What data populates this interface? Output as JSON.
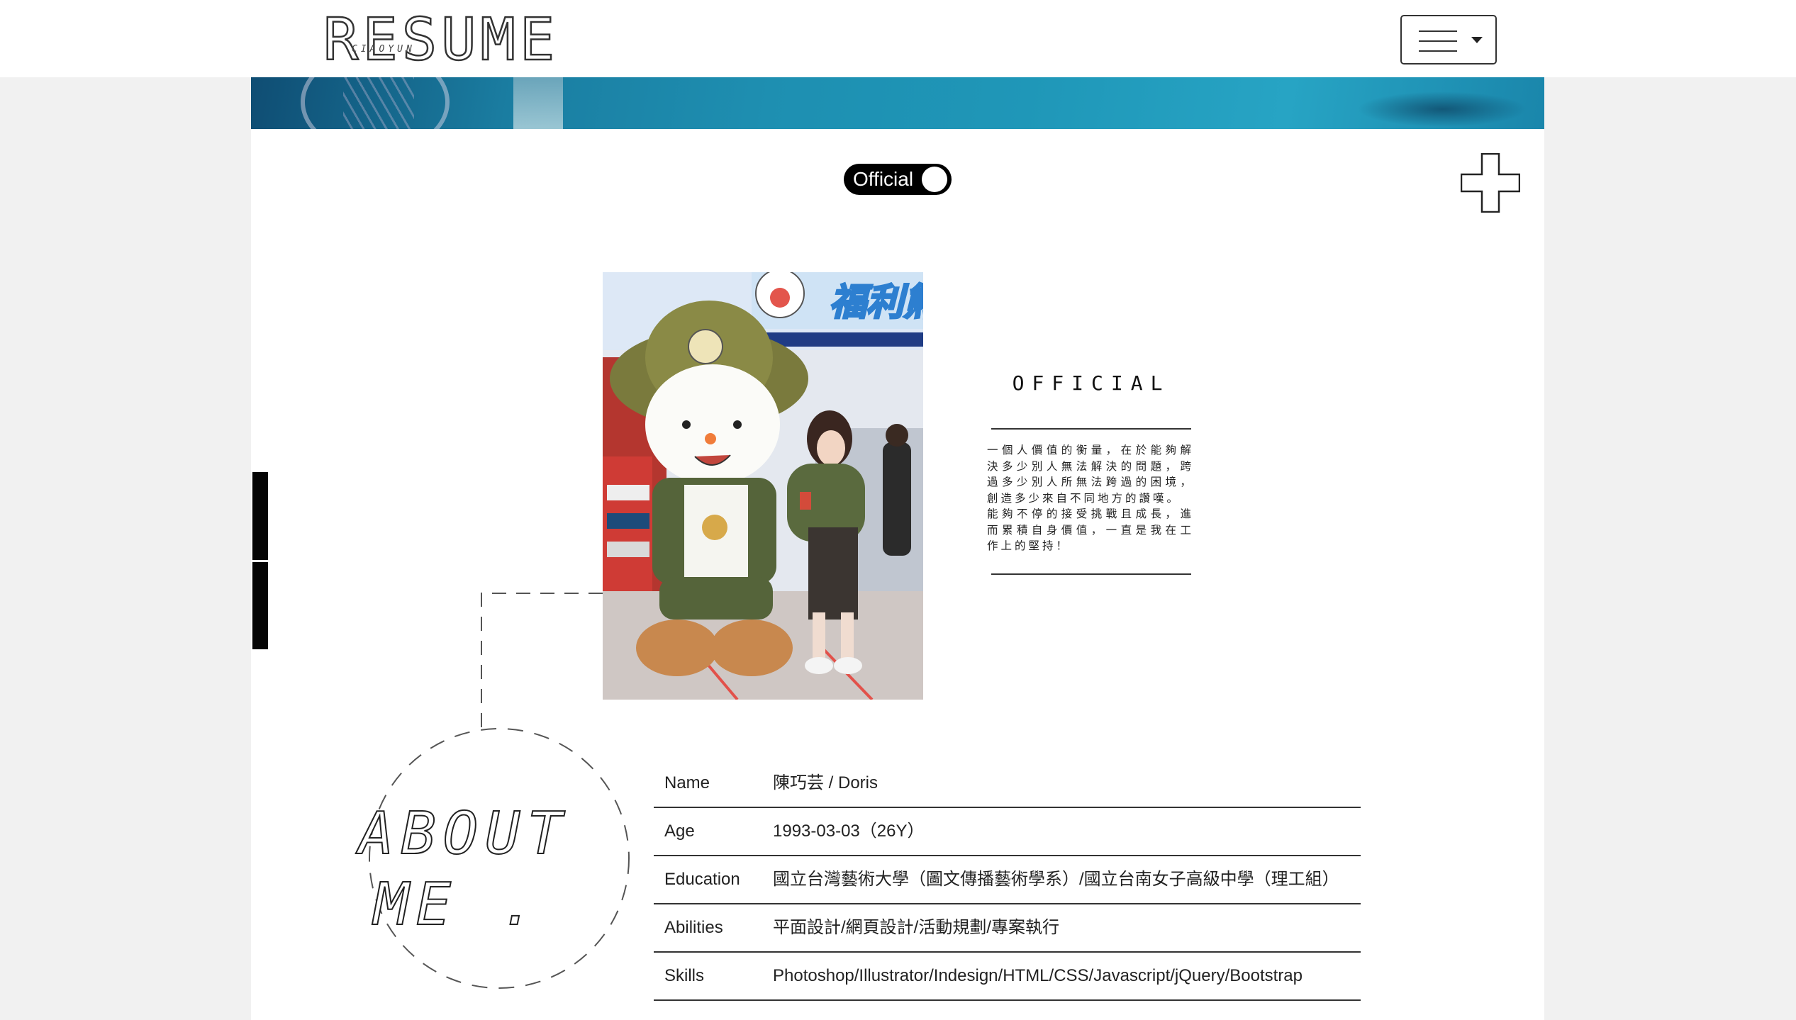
{
  "navbar": {
    "logo_text": "RESUME",
    "logo_subtext": "CIAOYUN"
  },
  "toggle": {
    "label": "Official"
  },
  "official": {
    "heading": "OFFICIAL",
    "paragraph_1": "一個人價值的衡量，在於能夠解決多少別人無法解決的問題，跨過多少別人所無法跨過的困境，創造多少來自不同地方的讚嘆。",
    "paragraph_2": "能夠不停的接受挑戰且成長，進而累積自身價值，一直是我在工作上的堅持！"
  },
  "about": {
    "line_1": "ABOUT",
    "line_2": "ME ."
  },
  "info": {
    "rows": [
      {
        "label": "Name",
        "value": "陳巧芸 / Doris"
      },
      {
        "label": "Age",
        "value": "1993-03-03（26Y）"
      },
      {
        "label": "Education",
        "value": "國立台灣藝術大學（圖文傳播藝術學系）/國立台南女子高級中學（理工組）"
      },
      {
        "label": "Abilities",
        "value": "平面設計/網頁設計/活動規劃/專案執行"
      },
      {
        "label": "Skills",
        "value": "Photoshop/Illustrator/Indesign/HTML/CSS/Javascript/jQuery/Bootstrap"
      }
    ]
  },
  "icons": {
    "menu": "hamburger-icon",
    "dropdown": "caret-down-icon",
    "expand": "plus-icon"
  },
  "colors": {
    "page_bg": "#f1f1f1",
    "container_bg": "#ffffff",
    "toggle_bg": "#000000",
    "banner": "#1f97b8"
  }
}
